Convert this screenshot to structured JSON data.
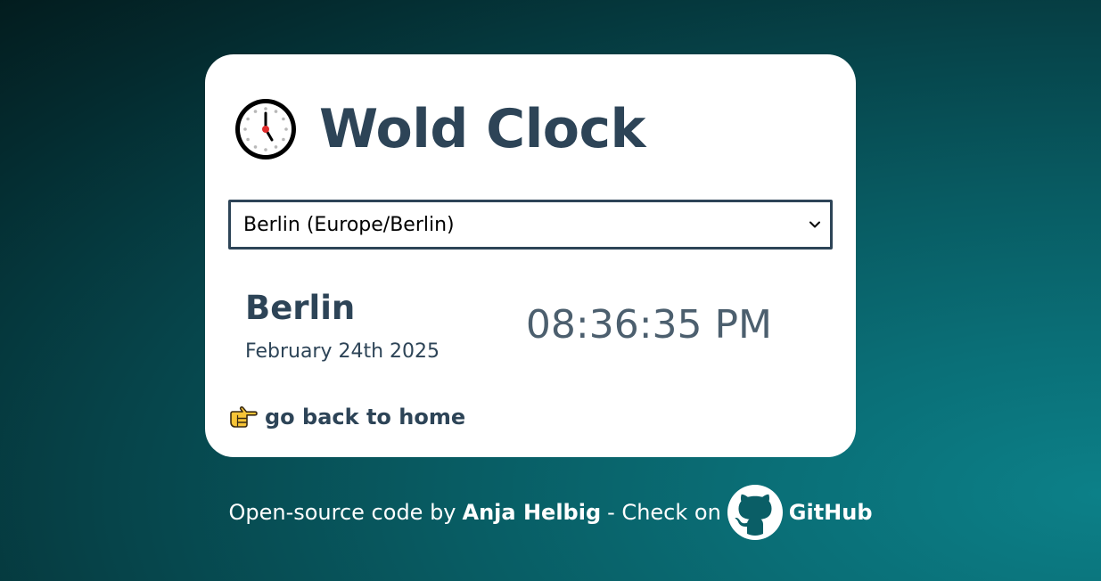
{
  "header": {
    "icon": "clock-icon",
    "title": "Wold Clock"
  },
  "city_select": {
    "selected": "Berlin (Europe/Berlin)"
  },
  "city": {
    "name": "Berlin",
    "date": "February 24th 2025",
    "time": "08:36:35 PM"
  },
  "back_link": {
    "icon": "pointing-hand-icon",
    "label": "go back to home"
  },
  "footer": {
    "prefix": "Open-source code by",
    "author": "Anja Helbig",
    "middle": "- Check on",
    "github_icon": "github-icon",
    "github_label": "GitHub"
  },
  "colors": {
    "primary_text": "#2d4457",
    "time_text": "#4c5f6e",
    "card_bg": "#ffffff",
    "background_dark": "#021516",
    "background_teal": "#0c8088"
  }
}
